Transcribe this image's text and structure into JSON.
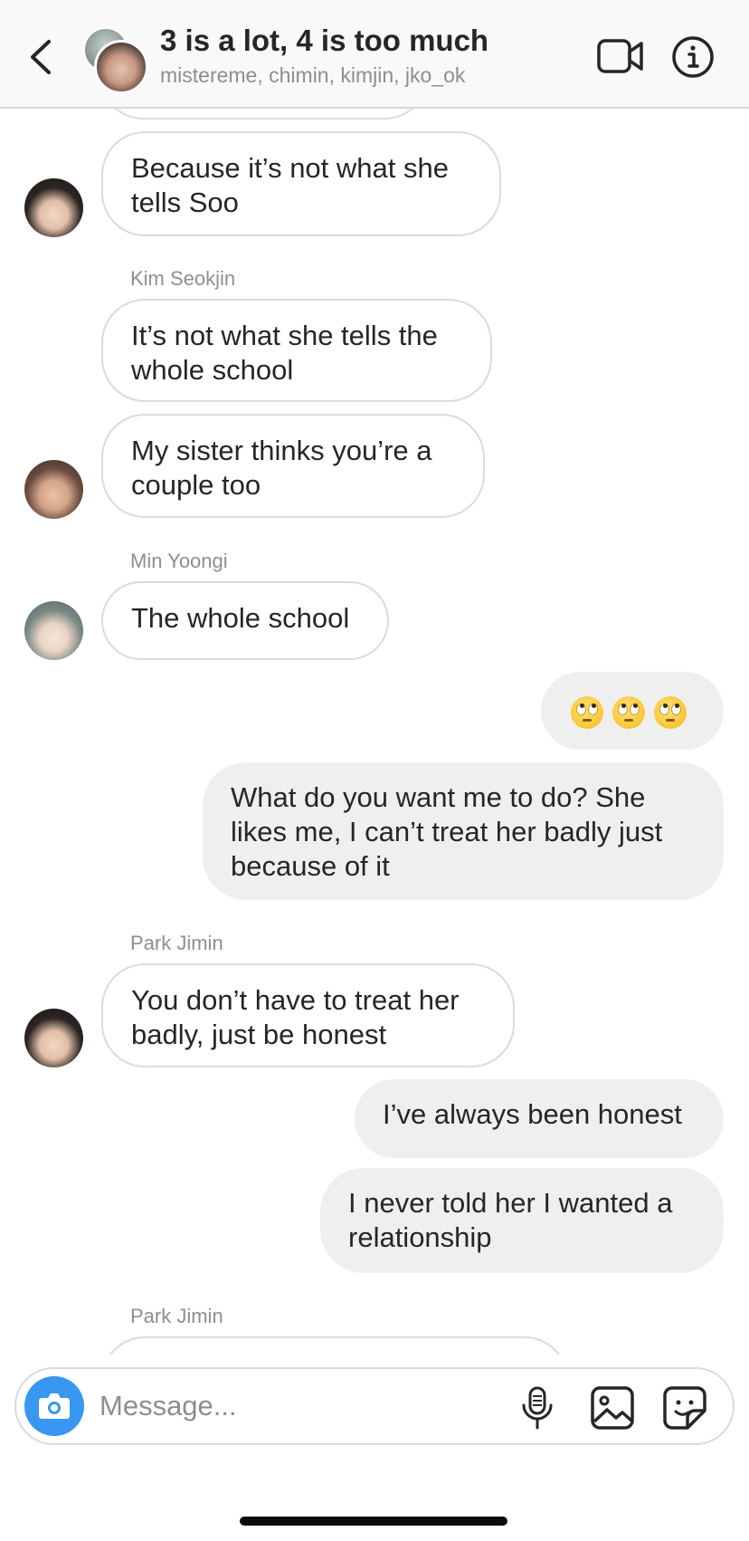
{
  "header": {
    "title": "3 is a lot, 4 is too much",
    "members": "mistereme, chimin, kimjin, jko_ok",
    "back_icon": "chevron-left-icon",
    "video_icon": "video-camera-icon",
    "info_icon": "info-icon"
  },
  "messages": [
    {
      "direction": "in",
      "text": "Because it’s not what she tells Soo"
    },
    {
      "direction": "in",
      "sender": "Kim Seokjin",
      "text": "It’s not what she tells the whole school"
    },
    {
      "direction": "in",
      "text": "My sister thinks you’re a couple too"
    },
    {
      "direction": "in",
      "sender": "Min Yoongi",
      "text": "The whole school"
    },
    {
      "direction": "out",
      "emoji": "face-with-rolling-eyes",
      "emoji_count": 3
    },
    {
      "direction": "out",
      "text": "What do you want me to do? She likes me, I can’t treat her badly just because of it"
    },
    {
      "direction": "in",
      "sender": "Park Jimin",
      "text": "You don’t have to treat her badly, just be honest"
    },
    {
      "direction": "out",
      "text": "I’ve always been honest"
    },
    {
      "direction": "out",
      "text": "I never told her I wanted a relationship"
    },
    {
      "direction": "in",
      "sender": "Park Jimin",
      "text": ""
    }
  ],
  "composer": {
    "placeholder": "Message...",
    "value": "",
    "camera_icon": "camera-icon",
    "mic_icon": "microphone-icon",
    "gallery_icon": "gallery-icon",
    "sticker_icon": "sticker-icon"
  },
  "colors": {
    "accent": "#3897f0",
    "incoming_border": "#dbdbdb",
    "outgoing_bg": "#efefef",
    "secondary_text": "#8e8e8e"
  }
}
